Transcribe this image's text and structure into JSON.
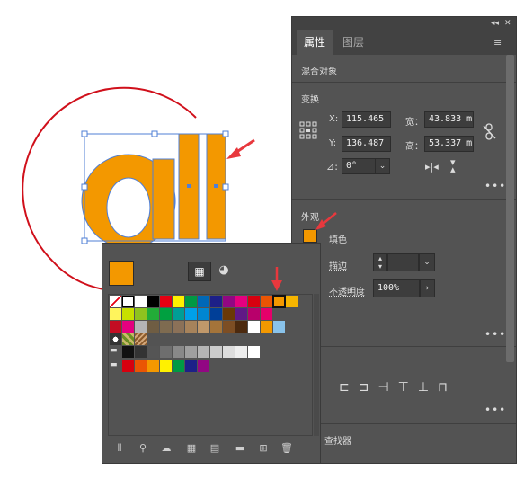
{
  "panel": {
    "tabs": [
      {
        "label": "属性",
        "active": true
      },
      {
        "label": "图层",
        "active": false
      }
    ],
    "collapse_glyph": "◂◂",
    "close_glyph": "≡",
    "object_type": "混合对象",
    "transform": {
      "title": "变换",
      "x_label": "X:",
      "x_value": "115.465",
      "y_label": "Y:",
      "y_value": "136.487",
      "w_label": "宽：",
      "w_value": "43.833 m",
      "h_label": "高：",
      "h_value": "53.337 m",
      "angle_value": "0°"
    },
    "appearance": {
      "title": "外观",
      "fill_label": "填色",
      "fill_color": "#f39800",
      "stroke_label": "描边",
      "opacity_label": "不透明度",
      "opacity_value": "100%"
    },
    "find_label": "查找器",
    "more_glyph": "•••"
  },
  "swatch_panel": {
    "current_color": "#f39800",
    "rows": [
      [
        "none",
        "reg",
        "#ffffff",
        "#000000",
        "#e60012",
        "#fff100",
        "#009944",
        "#0068b7",
        "#1d2088",
        "#920783",
        "#e4007f",
        "#d7000f",
        "#ea5504",
        "#f39800",
        "#f6b500"
      ],
      [
        "#fff45c",
        "#c7e000",
        "#8fc31f",
        "#22ac38",
        "#00a040",
        "#009e96",
        "#00a0e9",
        "#0086d1",
        "#003f98",
        "#6a3906",
        "#601986",
        "#b8006b",
        "#e5006a"
      ],
      [
        "#c30d23",
        "#e4007f",
        "#b5b5b6",
        "#6f5d43",
        "#7e6b50",
        "#8b7158",
        "#a7835b",
        "#c0986a",
        "#a4743a",
        "#7d4e24",
        "#4c2a0f",
        "#ffffff",
        "#f39800",
        "#89c3eb"
      ],
      [
        "pattern1",
        "pattern2",
        "pattern3"
      ],
      [
        "folder",
        "#111111",
        "#333333",
        "#555555",
        "#6e6e6e",
        "#898989",
        "#9f9f9f",
        "#b5b5b5",
        "#cccccc",
        "#dddddd",
        "#eeeeee",
        "#ffffff"
      ],
      [
        "folder",
        "#d7000f",
        "#ea5504",
        "#f39800",
        "#fff100",
        "#009944",
        "#1d2088",
        "#920783"
      ]
    ]
  },
  "colors": {
    "accent_orange": "#f39800",
    "arrow_red": "#e8383d",
    "selection_blue": "#4f7fd6"
  }
}
